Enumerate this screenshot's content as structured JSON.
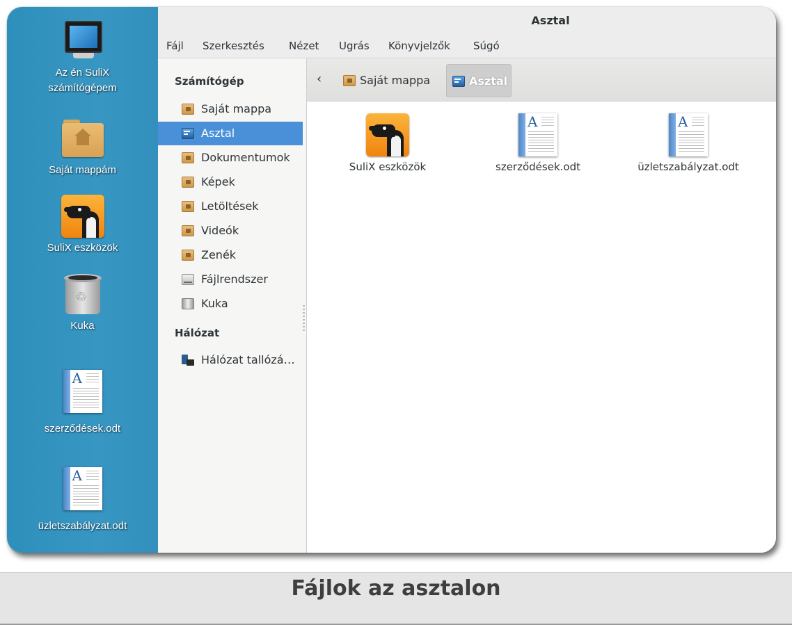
{
  "desktop": {
    "icons": [
      {
        "label_line1": "Az én SuliX",
        "label_line2": "számítógépem",
        "icon": "computer-icon"
      },
      {
        "label": "Saját mappám",
        "icon": "home-folder-icon"
      },
      {
        "label": "SuliX eszközök",
        "icon": "sulix-tools-icon"
      },
      {
        "label": "Kuka",
        "icon": "trash-icon"
      },
      {
        "label": "szerződések.odt",
        "icon": "document-icon"
      },
      {
        "label": "üzletszabályzat.odt",
        "icon": "document-icon"
      }
    ]
  },
  "window": {
    "title": "Asztal",
    "menu": [
      "Fájl",
      "Szerkesztés",
      "Nézet",
      "Ugrás",
      "Könyvjelzők",
      "Súgó"
    ]
  },
  "sidebar": {
    "sections": [
      {
        "heading": "Számítógép",
        "items": [
          {
            "label": "Saját mappa",
            "icon": "home-folder-icon",
            "active": false
          },
          {
            "label": "Asztal",
            "icon": "desktop-icon",
            "active": true
          },
          {
            "label": "Dokumentumok",
            "icon": "documents-folder-icon",
            "active": false
          },
          {
            "label": "Képek",
            "icon": "pictures-folder-icon",
            "active": false
          },
          {
            "label": "Letöltések",
            "icon": "downloads-folder-icon",
            "active": false
          },
          {
            "label": "Videók",
            "icon": "videos-folder-icon",
            "active": false
          },
          {
            "label": "Zenék",
            "icon": "music-folder-icon",
            "active": false
          },
          {
            "label": "Fájlrendszer",
            "icon": "drive-icon",
            "active": false
          },
          {
            "label": "Kuka",
            "icon": "trash-icon",
            "active": false
          }
        ]
      },
      {
        "heading": "Hálózat",
        "items": [
          {
            "label": "Hálózat tallózá…",
            "icon": "network-icon",
            "active": false
          }
        ]
      }
    ]
  },
  "pathbar": {
    "back_icon": "chevron-left-icon",
    "crumbs": [
      {
        "label": "Saját mappa",
        "icon": "home-folder-icon",
        "active": false
      },
      {
        "label": "Asztal",
        "icon": "desktop-icon",
        "active": true
      }
    ]
  },
  "files": [
    {
      "name": "SuliX eszközök",
      "icon": "sulix-tools-icon"
    },
    {
      "name": "szerződések.odt",
      "icon": "document-icon"
    },
    {
      "name": "üzletszabályzat.odt",
      "icon": "document-icon"
    }
  ],
  "colors": {
    "desktop_bg": "#3391bd",
    "selection": "#4a90d9",
    "sulix_orange": "#f7a02a"
  },
  "caption": "Fájlok az asztalon"
}
